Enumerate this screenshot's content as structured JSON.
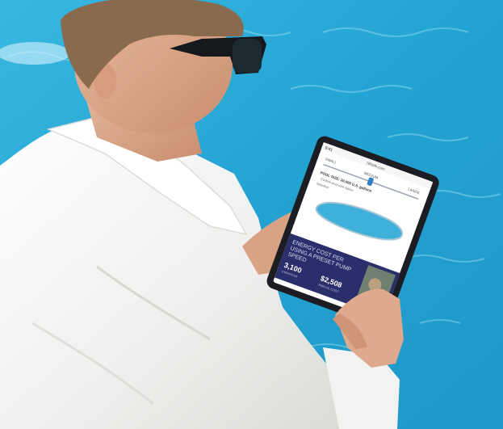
{
  "tablet": {
    "status_time": "9:41",
    "status_url": "hillside.com",
    "pool_size": {
      "small_label": "SMALL",
      "medium_label": "MEDIUM",
      "large_label": "LARGE",
      "pool_size_text": "POOL SIZE: 20,000 U.S. gallons",
      "note_line": "Custom pool-size option",
      "note_line2": "Selected"
    },
    "energy_banner": {
      "heading_line1": "ENERGY COST PER",
      "heading_line2": "USING A PRESET PUMP",
      "heading_line3": "SPEED",
      "left_value": "3,100",
      "left_label": "KWH/YEAR",
      "right_value": "$2,508",
      "right_label": "ANNUAL COST"
    }
  },
  "colors": {
    "pool_water": "#2aa9d6",
    "banner_navy": "#2a2f6b",
    "shirt_white": "#f4f4f2",
    "tablet_frame": "#1b1d22"
  }
}
